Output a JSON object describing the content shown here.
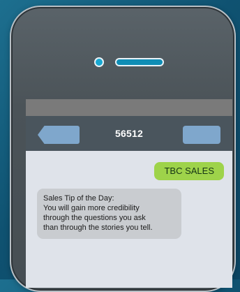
{
  "window": {
    "title": "56512"
  },
  "navigation": {
    "back_label": "",
    "action_label": ""
  },
  "messages": [
    {
      "direction": "sent",
      "text": "TBC SALES"
    },
    {
      "direction": "received",
      "lines": [
        "Sales Tip of the Day:",
        "You will gain more credibility",
        "through the questions you ask",
        "than through the stories you tell."
      ]
    }
  ],
  "colors": {
    "background": "#0f5271",
    "phone_body": "#4b5358",
    "phone_border": "#b8c0c6",
    "status_bar": "#7a7a7a",
    "nav_bar": "#4a555d",
    "nav_buttons": "#7fa7cc",
    "screen": "#dfe3ea",
    "sent_bubble": "#9ed34a",
    "received_bubble": "#c9ccd0",
    "camera": "#18a8d2"
  },
  "icons": {
    "camera": "camera-dot-icon",
    "speaker": "speaker-grille-icon"
  }
}
